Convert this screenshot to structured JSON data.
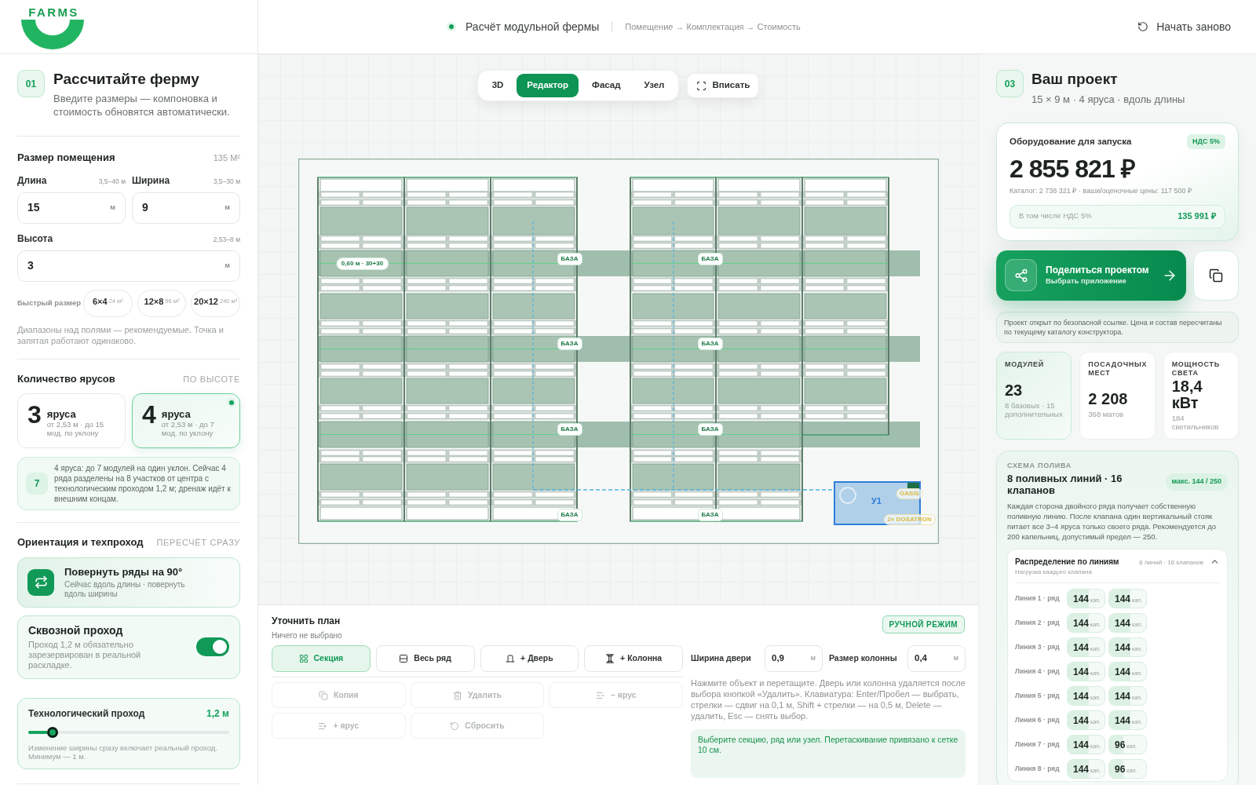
{
  "header": {
    "logo": "FARMS",
    "title": "Расчёт модульной фермы",
    "breadcrumb": "Помещение → Комплектация → Стоимость",
    "restart_button": "Начать заново"
  },
  "calculator": {
    "step": "01",
    "title": "Рассчитайте ферму",
    "subtitle": "Введите размеры — компоновка и стоимость обновятся автоматически.",
    "room": {
      "title": "Размер помещения",
      "area": "135 М²",
      "length": {
        "label": "Длина",
        "range": "3,5–40 м",
        "value": "15",
        "unit": "м"
      },
      "width": {
        "label": "Ширина",
        "range": "3,5–30 м",
        "value": "9",
        "unit": "м"
      },
      "height": {
        "label": "Высота",
        "range": "2,53–8 м",
        "value": "3",
        "unit": "м"
      },
      "quick_size": {
        "label": "Быстрый размер",
        "options": [
          {
            "size": "6×4",
            "area": "24 м²"
          },
          {
            "size": "12×8",
            "area": "96 м²"
          },
          {
            "size": "20×12",
            "area": "240 м²"
          }
        ]
      },
      "note": "Диапазоны над полями — рекомендуемые. Точка и запятая работают одинаково."
    },
    "tiers": {
      "title": "Количество ярусов",
      "hint": "ПО ВЫСОТЕ",
      "options": [
        {
          "count": "3",
          "unit": "яруса",
          "detail": "от 2,53 м · до 15 мод. по уклону",
          "selected": false
        },
        {
          "count": "4",
          "unit": "яруса",
          "detail": "от 2,53 м · до 7 мод. по уклону",
          "selected": true
        }
      ],
      "info": {
        "badge": "7",
        "text": "4 яруса: до 7 модулей на один уклон. Сейчас 4 ряда разделены на 8 участков от центра с технологическим проходом 1,2 м; дренаж идёт к внешним концам."
      }
    },
    "orientation": {
      "title": "Ориентация и техпроход",
      "hint": "ПЕРЕСЧЁТ СРАЗУ",
      "rotate": {
        "title": "Повернуть ряды на 90°",
        "subtitle": "Сейчас вдоль длины · повернуть вдоль ширины"
      },
      "through_pass": {
        "title": "Сквозной проход",
        "description": "Проход 1,2 м обязательно зарезервирован в реальной раскладке.",
        "on": true
      },
      "aisle": {
        "title": "Технологический проход",
        "reading": "1,2 м",
        "level": 0.12,
        "note": "Изменение ширины сразу включает реальный проход. Минимум — 1 м."
      }
    }
  },
  "editor": {
    "view_tabs": [
      {
        "label": "3D",
        "selected": false
      },
      {
        "label": "Редактор",
        "selected": true
      },
      {
        "label": "Фасад",
        "selected": false
      },
      {
        "label": "Узел",
        "selected": false
      }
    ],
    "fit_button": "Вписать",
    "plan": {
      "dimension_label": "0,60 м · 30+30",
      "base_labels": [
        "БАЗА",
        "БАЗА",
        "БАЗА",
        "БАЗА",
        "БАЗА",
        "БАЗА",
        "БАЗА",
        "БАЗА"
      ],
      "node_labels": [
        "У1",
        "OASIS",
        "2× DOSATRON"
      ]
    },
    "refine": {
      "title": "Уточнить план",
      "selection": "Ничего не выбрано",
      "mode_badge": "РУЧНОЙ РЕЖИМ",
      "tools": [
        {
          "label": "Секция",
          "kind": "grid",
          "selected": true
        },
        {
          "label": "Весь ряд",
          "kind": "rows",
          "selected": false
        },
        {
          "label": "+ Дверь",
          "kind": "door",
          "selected": false
        },
        {
          "label": "+ Колонна",
          "kind": "column",
          "selected": false
        }
      ],
      "actions": [
        {
          "label": "Копия",
          "kind": "copy",
          "disabled": true
        },
        {
          "label": "Удалить",
          "kind": "trash",
          "disabled": true
        },
        {
          "label": "− ярус",
          "kind": "tier-minus",
          "disabled": true
        },
        {
          "label": "+ ярус",
          "kind": "tier-plus",
          "disabled": true
        },
        {
          "label": "Сбросить",
          "kind": "reset",
          "disabled": true
        }
      ],
      "door_width": {
        "label": "Ширина двери",
        "value": "0,9",
        "unit": "м"
      },
      "column_size": {
        "label": "Размер колонны",
        "value": "0,4",
        "unit": "м"
      },
      "help": "Нажмите объект и перетащите. Дверь или колонна удаляется после выбора кнопкой «Удалить». Клавиатура: Enter/Пробел — выбрать, стрелки — сдвиг на 0,1 м, Shift + стрелки — на 0,5 м, Delete — удалить, Esc — снять выбор.",
      "status": "Выберите секцию, ряд или узел. Перетаскивание привязано к сетке 10 см."
    }
  },
  "project": {
    "step": "03",
    "title": "Ваш проект",
    "summary": "15 × 9 м · 4 яруса · вдоль длины",
    "equipment": {
      "title": "Оборудование для запуска",
      "vat_badge": "НДС 5%",
      "total": "2 855 821 ₽",
      "catalog": "Каталог: 2 738 321 ₽ · ваши/оценочные цены: 117 500 ₽",
      "vat_label": "В том числе НДС 5%",
      "vat_value": "135 991 ₽"
    },
    "share": {
      "title": "Поделиться проектом",
      "subtitle": "Выбрать приложение"
    },
    "notice": "Проект открыт по безопасной ссылке. Цена и состав пересчитаны по текущему каталогу конструктора.",
    "stats": [
      {
        "label": "МОДУЛЕЙ",
        "value": "23",
        "detail": "8 базовых · 15 дополнительных",
        "selected": true
      },
      {
        "label": "ПОСАДОЧНЫХ МЕСТ",
        "value": "2 208",
        "detail": "368 матов",
        "selected": false
      },
      {
        "label": "МОЩНОСТЬ СВЕТА",
        "value": "18,4 кВт",
        "detail": "184 светильников",
        "selected": false
      }
    ],
    "irrigation": {
      "kicker": "СХЕМА ПОЛИВА",
      "title": "8 поливных линий · 16 клапанов",
      "badge": "макс. 144 / 250",
      "description": "Каждая сторона двойного ряда получает собственную поливную линию. После клапана один вертикальный стояк питает все 3–4 яруса только своего ряда. Рекомендуется до 200 капельниц, допустимый предел — 250.",
      "distribution": {
        "title": "Распределение по линиям",
        "subtitle": "Нагрузка каждого клапана",
        "summary": "8 линий · 16 клапанов",
        "expanded": true,
        "lines": [
          {
            "label": "Линия 1 · ряд",
            "valves": [
              {
                "value": "144",
                "unit": "кап.",
                "level": 0.576
              },
              {
                "value": "144",
                "unit": "кап.",
                "level": 0.576
              }
            ]
          },
          {
            "label": "Линия 2 · ряд",
            "valves": [
              {
                "value": "144",
                "unit": "кап.",
                "level": 0.576
              },
              {
                "value": "144",
                "unit": "кап.",
                "level": 0.576
              }
            ]
          },
          {
            "label": "Линия 3 · ряд",
            "valves": [
              {
                "value": "144",
                "unit": "кап.",
                "level": 0.576
              },
              {
                "value": "144",
                "unit": "кап.",
                "level": 0.576
              }
            ]
          },
          {
            "label": "Линия 4 · ряд",
            "valves": [
              {
                "value": "144",
                "unit": "кап.",
                "level": 0.576
              },
              {
                "value": "144",
                "unit": "кап.",
                "level": 0.576
              }
            ]
          },
          {
            "label": "Линия 5 · ряд",
            "valves": [
              {
                "value": "144",
                "unit": "кап.",
                "level": 0.576
              },
              {
                "value": "144",
                "unit": "кап.",
                "level": 0.576
              }
            ]
          },
          {
            "label": "Линия 6 · ряд",
            "valves": [
              {
                "value": "144",
                "unit": "кап.",
                "level": 0.576
              },
              {
                "value": "144",
                "unit": "кап.",
                "level": 0.576
              }
            ]
          },
          {
            "label": "Линия 7 · ряд",
            "valves": [
              {
                "value": "144",
                "unit": "кап.",
                "level": 0.576
              },
              {
                "value": "96",
                "unit": "кап.",
                "level": 0.384
              }
            ]
          },
          {
            "label": "Линия 8 · ряд",
            "valves": [
              {
                "value": "144",
                "unit": "кап.",
                "level": 0.576
              },
              {
                "value": "96",
                "unit": "кап.",
                "level": 0.384
              }
            ]
          }
        ]
      }
    }
  }
}
